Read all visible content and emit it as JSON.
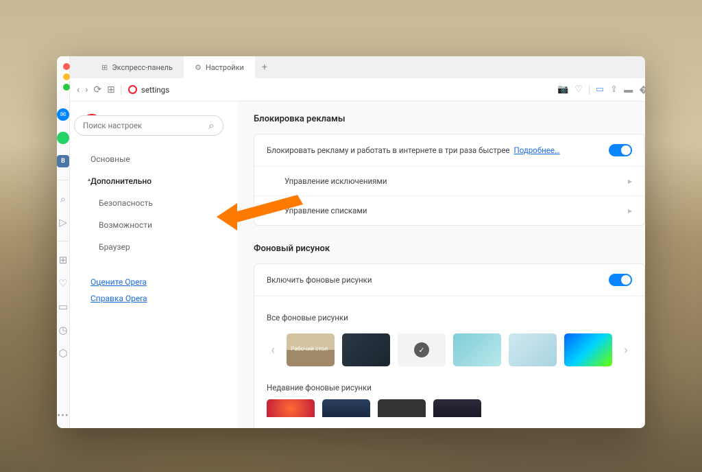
{
  "tabs": {
    "speed_dial": "Экспресс-панель",
    "settings": "Настройки"
  },
  "address": {
    "url": "settings"
  },
  "page": {
    "title": "Настройки",
    "search_placeholder": "Поиск настроек"
  },
  "sidebar": {
    "basic": "Основные",
    "advanced": "Дополнительно",
    "security": "Безопасность",
    "features": "Возможности",
    "browser": "Браузер",
    "rate": "Оцените Opera",
    "help": "Справка Opera"
  },
  "sections": {
    "adblock": {
      "title": "Блокировка рекламы",
      "desc": "Блокировать рекламу и работать в интернете в три раза быстрее",
      "more": "Подробнее…",
      "exceptions": "Управление исключениями",
      "lists": "Управление списками"
    },
    "wallpaper": {
      "title": "Фоновый рисунок",
      "enable": "Включить фоновые рисунки",
      "all": "Все фоновые рисунки",
      "desktop": "Рабочий стол",
      "recent": "Недавние фоновые рисунки"
    }
  }
}
